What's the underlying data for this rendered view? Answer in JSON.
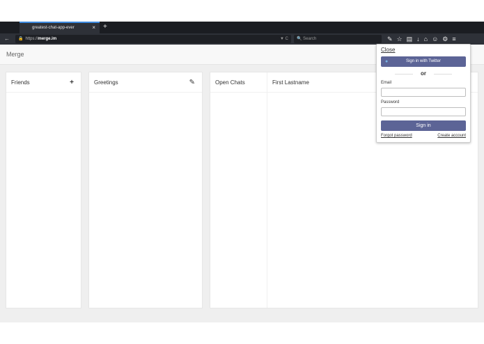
{
  "browser": {
    "tab_title": "greatest-chat-app-ever",
    "tab_close": "×",
    "new_tab": "+",
    "back": "←",
    "url_prefix": "https://",
    "url_domain": "merge.im",
    "url_controls": "▼ C",
    "search_placeholder": "Search",
    "toolbar_icons": [
      "wrench-icon",
      "star-icon",
      "reading-list-icon",
      "download-icon",
      "home-icon",
      "smiley-icon",
      "extension-icon",
      "menu-icon"
    ]
  },
  "app": {
    "brand": "Merge"
  },
  "panels": {
    "friends": {
      "title": "Friends",
      "action": "+"
    },
    "greetings": {
      "title": "Greetings",
      "action": "✎"
    },
    "chats": {
      "title": "Open Chats",
      "contact": "First Lastname"
    }
  },
  "signin_popup": {
    "close": "Close",
    "twitter_button": "Sign in with Twitter",
    "or": "or",
    "email_label": "Email",
    "password_label": "Password",
    "signin_button": "Sign in",
    "forgot_password": "Forgot password",
    "create_account": "Create account"
  },
  "colors": {
    "browser_chrome": "#2e3138",
    "tab_strip": "#1b1d22",
    "button_primary": "#5c6496",
    "content_bg": "#efefef"
  }
}
